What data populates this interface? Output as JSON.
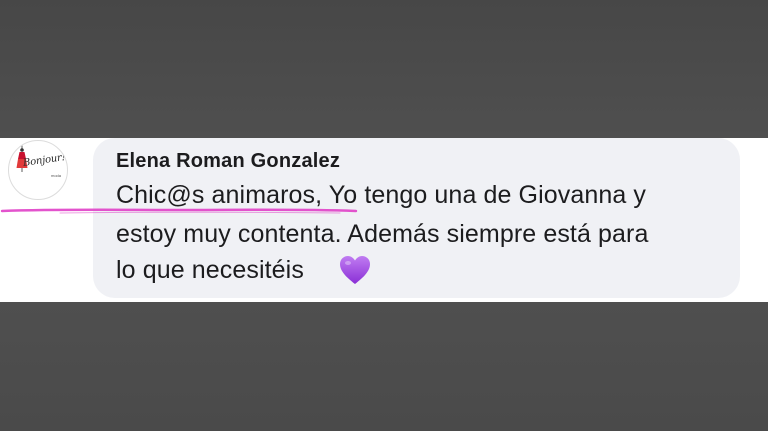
{
  "comment": {
    "avatar": {
      "brand": "Bonjour!",
      "subtitle": "moda",
      "icon": "dress-mannequin-icon"
    },
    "author": "Elena Roman Gonzalez",
    "lines": [
      "Chic@s animaros, Yo tengo una de Giovanna y",
      "estoy muy contenta. Además siempre está para",
      "lo que necesitéis"
    ],
    "emoji": "purple-heart-icon",
    "colors": {
      "underline": "#e040c8",
      "heart": "#a24be0",
      "bubble": "#f0f1f5"
    }
  }
}
